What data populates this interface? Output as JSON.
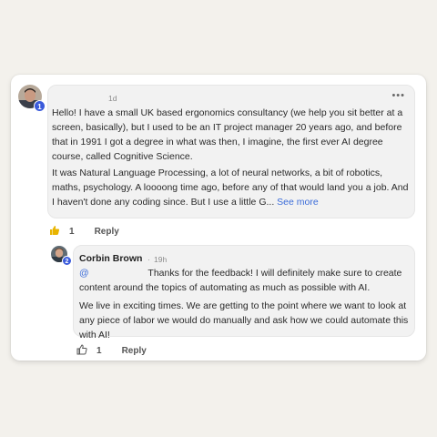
{
  "comment": {
    "author_badge": "1",
    "timestamp": "1d",
    "more_icon": "ellipsis-icon",
    "paragraphs": [
      "Hello! I have a small UK based ergonomics consultancy (we help you sit better at a screen, basically), but I used to be an IT project manager 20 years ago, and before that in 1991 I got a degree in what was then, I imagine, the first ever AI degree course, called Cognitive Science.",
      "It was Natural Language Processing, a lot of neural networks, a bit of robotics, maths, psychology. A loooong time ago, before any of that would land you a job. And I haven't done any coding since. But I use a little G..."
    ],
    "see_more": "See more",
    "like_count": "1",
    "reply_label": "Reply"
  },
  "reply": {
    "author": "Corbin Brown",
    "author_badge": "2",
    "separator": "·",
    "timestamp": "19h",
    "mention_prefix": "@",
    "paragraph1": "Thanks for the feedback! I will definitely make sure to create content around the topics of automating as much as possible with AI.",
    "paragraph2": "We live in exciting times. We are getting to the point where we want to look at any piece of labor we would do manually and ask how we could automate this with AI!",
    "like_count": "1",
    "reply_label": "Reply"
  },
  "colors": {
    "background": "#f3f1ec",
    "link": "#3b6cd9",
    "badge": "#3b5bdb",
    "like_icon": "#e8b400"
  }
}
